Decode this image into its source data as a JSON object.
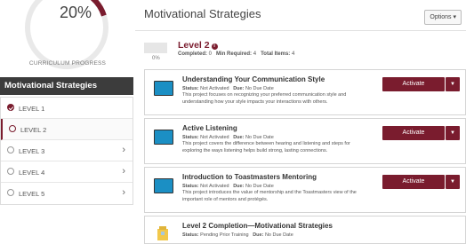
{
  "sidebar": {
    "progress": {
      "percent_text": "20%",
      "fraction": 0.2,
      "label": "CURRICULUM PROGRESS"
    },
    "path_title": "Motivational Strategies",
    "levels": [
      {
        "label": "LEVEL 1",
        "state": "completed"
      },
      {
        "label": "LEVEL 2",
        "state": "active"
      },
      {
        "label": "LEVEL 3",
        "state": "locked"
      },
      {
        "label": "LEVEL 4",
        "state": "locked"
      },
      {
        "label": "LEVEL 5",
        "state": "locked"
      }
    ]
  },
  "main": {
    "title": "Motivational Strategies",
    "options_label": "Options ▾",
    "level": {
      "title": "Level 2",
      "info_icon": "i",
      "percent_text": "0%",
      "completed_label": "Completed:",
      "completed_value": "0",
      "min_label": "Min Required:",
      "min_value": "4",
      "total_label": "Total Items:",
      "total_value": "4"
    },
    "projects": [
      {
        "title": "Understanding Your Communication Style",
        "status_label": "Status:",
        "status": "Not Activated",
        "due_label": "Due:",
        "due": "No Due Date",
        "description": "This project focuses on recognizing your preferred communication style and understanding how your style impacts your interactions with others.",
        "action": "Activate"
      },
      {
        "title": "Active Listening",
        "status_label": "Status:",
        "status": "Not Activated",
        "due_label": "Due:",
        "due": "No Due Date",
        "description": "This project covers the difference between hearing and listening and steps for exploring the ways listening helps build strong, lasting connections.",
        "action": "Activate"
      },
      {
        "title": "Introduction to Toastmasters Mentoring",
        "status_label": "Status:",
        "status": "Not Activated",
        "due_label": "Due:",
        "due": "No Due Date",
        "description": "This project introduces the value of mentorship and the Toastmasters view of the important role of mentors and protégés.",
        "action": "Activate"
      }
    ],
    "completion": {
      "title": "Level 2 Completion—Motivational Strategies",
      "status_label": "Status:",
      "status": "Pending Prior Training",
      "due_label": "Due:",
      "due": "No Due Date"
    }
  },
  "colors": {
    "accent": "#7a1c2e",
    "dark_header": "#3c3c3c",
    "thumb_blue": "#1b8fc4"
  }
}
